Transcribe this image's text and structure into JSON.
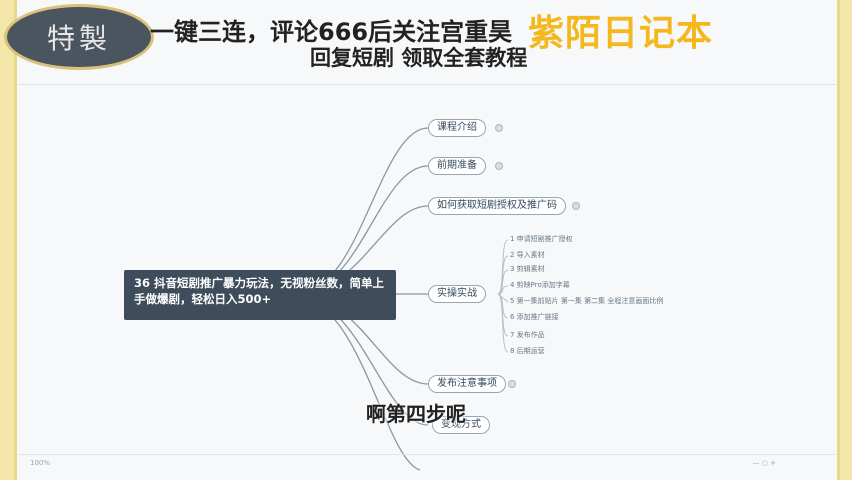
{
  "overlay": {
    "badge": "特製",
    "headline": "一键三连，评论666后关注宫重昊",
    "subline": "回复短剧 领取全套教程",
    "brand": "紫陌日记本",
    "caption": "啊第四步呢"
  },
  "mindmap": {
    "central": "36 抖音短剧推广暴力玩法，无视粉丝数，简单上手做爆剧，轻松日入500+",
    "branches": [
      "课程介绍",
      "前期准备",
      "如何获取短剧授权及推广码",
      "实操实战",
      "发布注意事项",
      "变现方式"
    ],
    "subitems": [
      "1 申请短剧推广授权",
      "2 导入素材",
      "3 剪辑素材",
      "4 剪映Pro添加字幕",
      "5 第一集前贴片 第一集 第二集 全程注意画面比例",
      "6 添加推广链接",
      "7 发布作品",
      "8 后期运营"
    ]
  },
  "status": {
    "left": "100%",
    "right": "— ○ +"
  }
}
